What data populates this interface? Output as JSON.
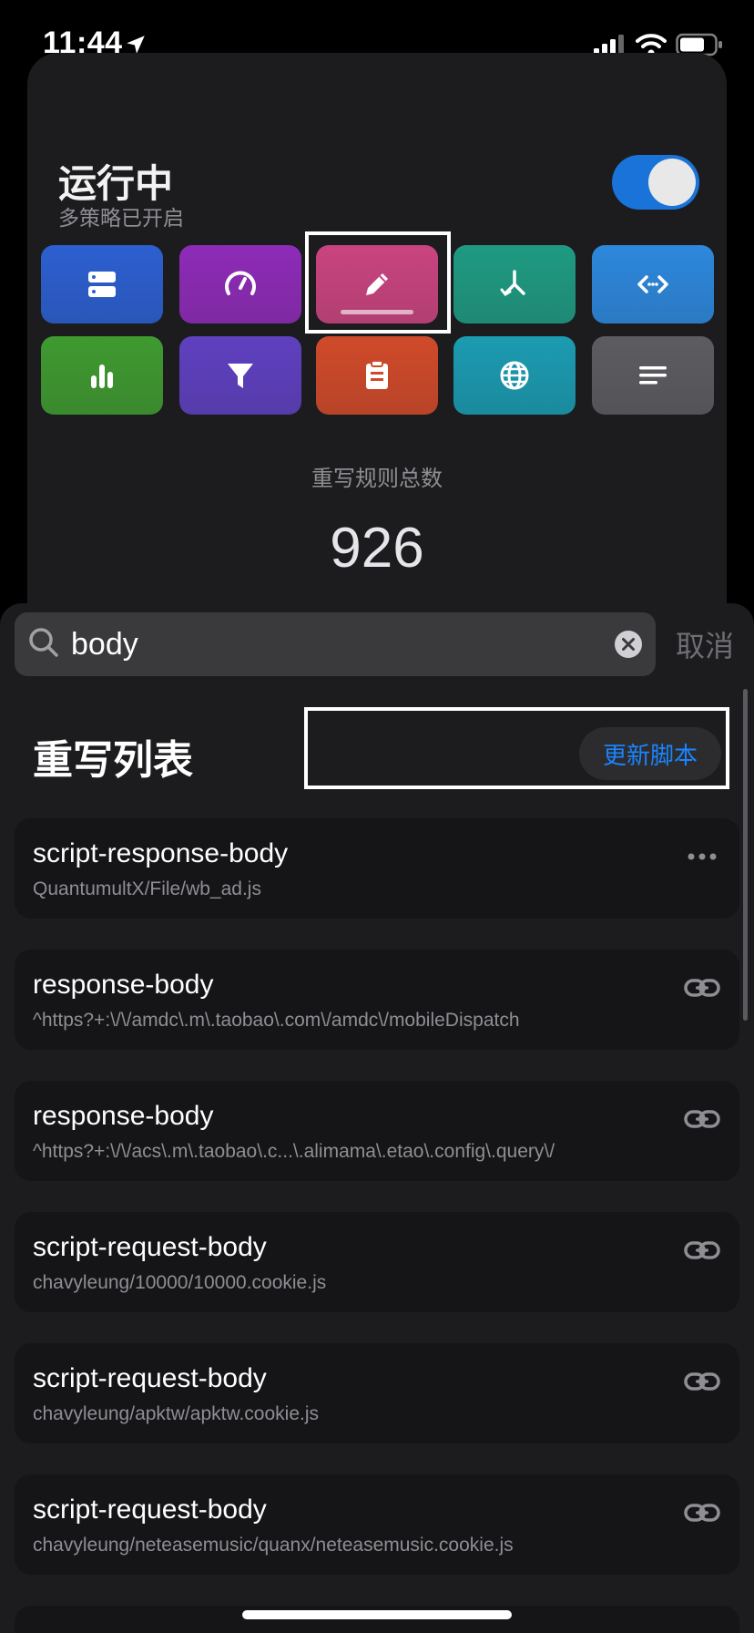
{
  "status_bar": {
    "time": "11:44"
  },
  "header": {
    "title": "运行中",
    "subtitle": "多策略已开启",
    "toggle_on": true
  },
  "tiles": [
    {
      "icon": "server-icon",
      "color": "#2c5fd0"
    },
    {
      "icon": "speedometer-icon",
      "color": "#8e2bb7"
    },
    {
      "icon": "pencil-icon",
      "color": "#c9447f",
      "selected": true
    },
    {
      "icon": "branch-icon",
      "color": "#1f9a82"
    },
    {
      "icon": "code-icon",
      "color": "#2d88dc"
    },
    {
      "icon": "bar-chart-icon",
      "color": "#3f9a30"
    },
    {
      "icon": "filter-icon",
      "color": "#5f40c0"
    },
    {
      "icon": "clipboard-icon",
      "color": "#d04a2a"
    },
    {
      "icon": "globe-icon",
      "color": "#1b9bb1"
    },
    {
      "icon": "lines-icon",
      "color": "#5c5c61"
    }
  ],
  "stat": {
    "label": "重写规则总数",
    "value": "926"
  },
  "search": {
    "value": "body",
    "cancel_label": "取消"
  },
  "list": {
    "title": "重写列表",
    "update_label": "更新脚本",
    "items": [
      {
        "title": "script-response-body",
        "subtitle": "QuantumultX/File/wb_ad.js",
        "action": "more-icon"
      },
      {
        "title": "response-body",
        "subtitle": "^https?+:\\/\\/amdc\\.m\\.taobao\\.com\\/amdc\\/mobileDispatch",
        "action": "link-icon"
      },
      {
        "title": "response-body",
        "subtitle": "^https?+:\\/\\/acs\\.m\\.taobao\\.c...\\.alimama\\.etao\\.config\\.query\\/",
        "action": "link-icon"
      },
      {
        "title": "script-request-body",
        "subtitle": "chavyleung/10000/10000.cookie.js",
        "action": "link-icon"
      },
      {
        "title": "script-request-body",
        "subtitle": "chavyleung/apktw/apktw.cookie.js",
        "action": "link-icon"
      },
      {
        "title": "script-request-body",
        "subtitle": "chavyleung/neteasemusic/quanx/neteasemusic.cookie.js",
        "action": "link-icon"
      }
    ]
  }
}
